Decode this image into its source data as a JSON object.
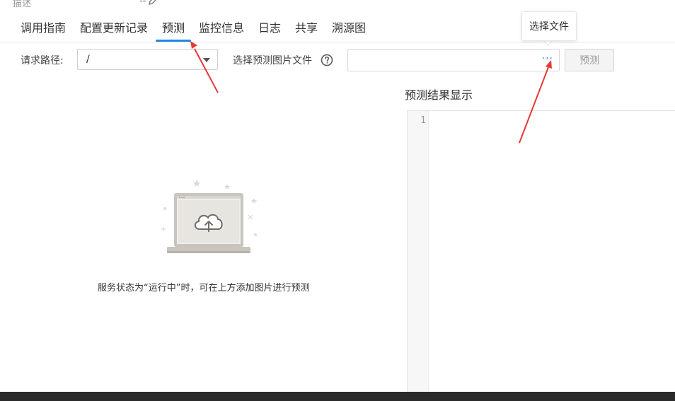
{
  "header": {
    "desc_label": "描述",
    "desc_value": "--",
    "edit_icon": "pencil-icon"
  },
  "tabs": [
    {
      "label": "调用指南"
    },
    {
      "label": "配置更新记录"
    },
    {
      "label": "预测",
      "active": true
    },
    {
      "label": "监控信息"
    },
    {
      "label": "日志"
    },
    {
      "label": "共享"
    },
    {
      "label": "溯源图"
    }
  ],
  "tooltip": {
    "text": "选择文件"
  },
  "form": {
    "path_label": "请求路径:",
    "path_value": "/",
    "file_label": "选择预测图片文件",
    "help_icon": "question-circle-icon",
    "file_value": "",
    "browse_label": "···",
    "predict_button": "预测"
  },
  "result": {
    "title": "预测结果显示",
    "line_numbers": [
      "1"
    ]
  },
  "empty_state": {
    "illustration": "laptop-cloud-upload-icon",
    "message": "服务状态为“运行中”时，可在上方添加图片进行预测"
  },
  "colors": {
    "accent": "#1e88e5",
    "annotation_arrow": "#e53935"
  }
}
